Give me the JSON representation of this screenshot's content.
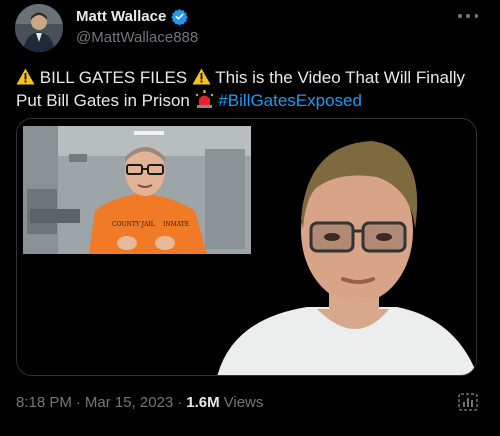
{
  "user": {
    "display_name": "Matt Wallace",
    "handle": "@MattWallace888",
    "verified": true
  },
  "tweet": {
    "text_part1": "BILL GATES FILES",
    "text_part2": "This is the Video That Will Finally Put Bill Gates in Prison",
    "hashtag": "#BillGatesExposed",
    "icons": [
      "warning-icon",
      "warning-icon",
      "siren-icon"
    ]
  },
  "media": {
    "inset_jumpsuit_text_left": "COUNTY JAIL",
    "inset_jumpsuit_text_right": "INMATE"
  },
  "meta": {
    "time": "8:18 PM",
    "separator1": "·",
    "date": "Mar 15, 2023",
    "separator2": "·",
    "views_count": "1.6M",
    "views_label": "Views"
  },
  "colors": {
    "background": "#000000",
    "text_primary": "#e7e9ea",
    "text_secondary": "#71767b",
    "link": "#1d9bf0",
    "border": "#2f3336"
  }
}
